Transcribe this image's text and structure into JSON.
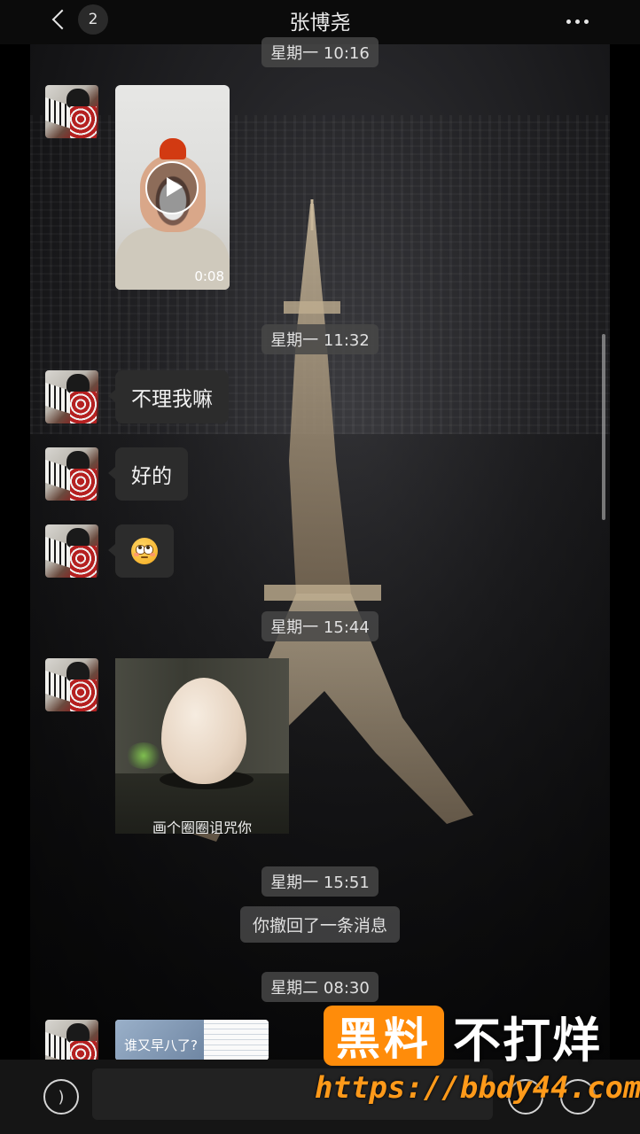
{
  "header": {
    "back_badge": "2",
    "title": "张博尧"
  },
  "messages": {
    "ts1": "星期一 10:16",
    "video_duration": "0:08",
    "ts2": "星期一 11:32",
    "text1": "不理我嘛",
    "text2": "好的",
    "ts3": "星期一 15:44",
    "sticker_caption": "画个圈圈诅咒你",
    "ts4": "星期一 15:51",
    "system_recall": "你撤回了一条消息",
    "ts5": "星期二 08:30",
    "image_snippet_text": "谁又早八了?"
  },
  "watermark": {
    "brand_box": "黑料",
    "brand_text": "不打烊",
    "url": "https://bbdy44.com"
  },
  "icons": {
    "back": "chevron-left-icon",
    "more": "ellipsis-icon",
    "voice": "voice-icon",
    "emoji": "emoji-icon",
    "plus": "plus-icon"
  },
  "colors": {
    "bubble": "#2c2c2c",
    "timestamp_bg": "#464646",
    "watermark_orange": "#ff8c0a"
  }
}
